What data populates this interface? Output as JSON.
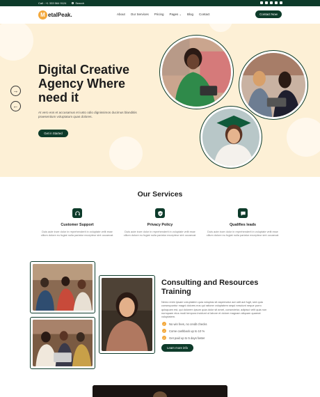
{
  "topbar": {
    "phone": "Call : +1 333 564 9124",
    "search": "Search",
    "social_icons": [
      "facebook-icon",
      "twitter-icon",
      "youtube-icon",
      "linkedin-icon",
      "instagram-icon"
    ]
  },
  "nav": {
    "logo_mark": "M",
    "logo_text": "etalPeak.",
    "items": [
      "About",
      "Our Services",
      "Pricing",
      "Pages",
      "Blog",
      "Contact"
    ],
    "contact_button": "Contact Now"
  },
  "hero": {
    "title": "Digital Creative Agency Where need it",
    "subtitle": "At vero eos et accusamus et iusto odio dignissimos ducimus blanditiis praesentium voluptatum quas dolores.",
    "button": "Get in Started",
    "arrow_next": "→",
    "arrow_prev": "←"
  },
  "services": {
    "title": "Our Services",
    "items": [
      {
        "icon": "headset-icon",
        "title": "Customer Support",
        "text": "Duis aute irure dolor in reprehenderit in voluptate velit esse cillum dolore eu fugiat nulla pariatur excepteur sint occaecat."
      },
      {
        "icon": "shield-icon",
        "title": "Privacy Policy",
        "text": "Duis aute irure dolor in reprehenderit in voluptate velit esse cillum dolore eu fugiat nulla pariatur excepteur sint occaecat."
      },
      {
        "icon": "chat-icon",
        "title": "Qualifies leads",
        "text": "Duis aute irure dolor in reprehenderit in voluptate velit esse cillum dolore eu fugiat nulla pariatur excepteur sint occaecat."
      }
    ]
  },
  "consulting": {
    "title": "Consulting and Resources Training",
    "text": "Nemo enim ipsam voluptatem quia voluptas sit aspernatur aut odit aut fugit, sed quia consequuntur magni dolores eos qui ratione voluptatem sequi nesciunt neque porro quisquam est, qui dolorem ipsum quia dolor sit amet, consectetur, adipisci velit quia non numquam eius modi tempora incidunt ut labore et dolore magnam aliquam quaerat voluptatem.",
    "checks": [
      "No win fees, no credit checks",
      "Come cashback up to 10 %",
      "Get paid up to 5 days faster"
    ],
    "button": "Learn more info"
  },
  "colors": {
    "brand_dark": "#0d3b2a",
    "accent": "#f3a83b",
    "hero_bg": "#fdf0d6"
  }
}
